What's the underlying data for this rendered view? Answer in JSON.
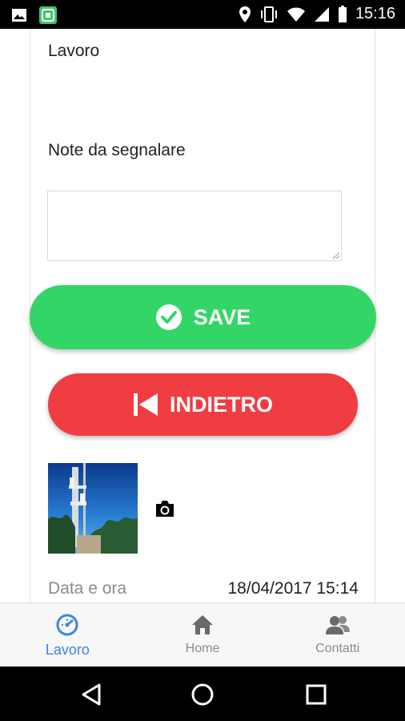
{
  "status_bar": {
    "time": "15:16",
    "icons": [
      "gallery-icon",
      "app-notification-icon",
      "location-icon",
      "vibrate-icon",
      "wifi-icon",
      "signal-icon",
      "battery-icon"
    ]
  },
  "form": {
    "section_label": "Lavoro",
    "notes_label": "Note da segnalare",
    "notes_value": ""
  },
  "buttons": {
    "save_label": "SAVE",
    "back_label": "INDIETRO"
  },
  "colors": {
    "save": "#33d567",
    "back": "#f03d42",
    "tab_active": "#3b86e0",
    "tab_inactive": "#8a8a8a"
  },
  "photo": {
    "thumbnail_icon": "photo-thumbnail",
    "camera_icon": "camera-icon"
  },
  "meta": {
    "date_label": "Data e ora",
    "date_value": "18/04/2017 15:14"
  },
  "tabs": [
    {
      "label": "Lavoro",
      "icon": "speedometer-icon",
      "active": true
    },
    {
      "label": "Home",
      "icon": "home-icon",
      "active": false
    },
    {
      "label": "Contatti",
      "icon": "contacts-icon",
      "active": false
    }
  ],
  "nav": [
    "back-icon",
    "home-circle-icon",
    "recents-icon"
  ]
}
